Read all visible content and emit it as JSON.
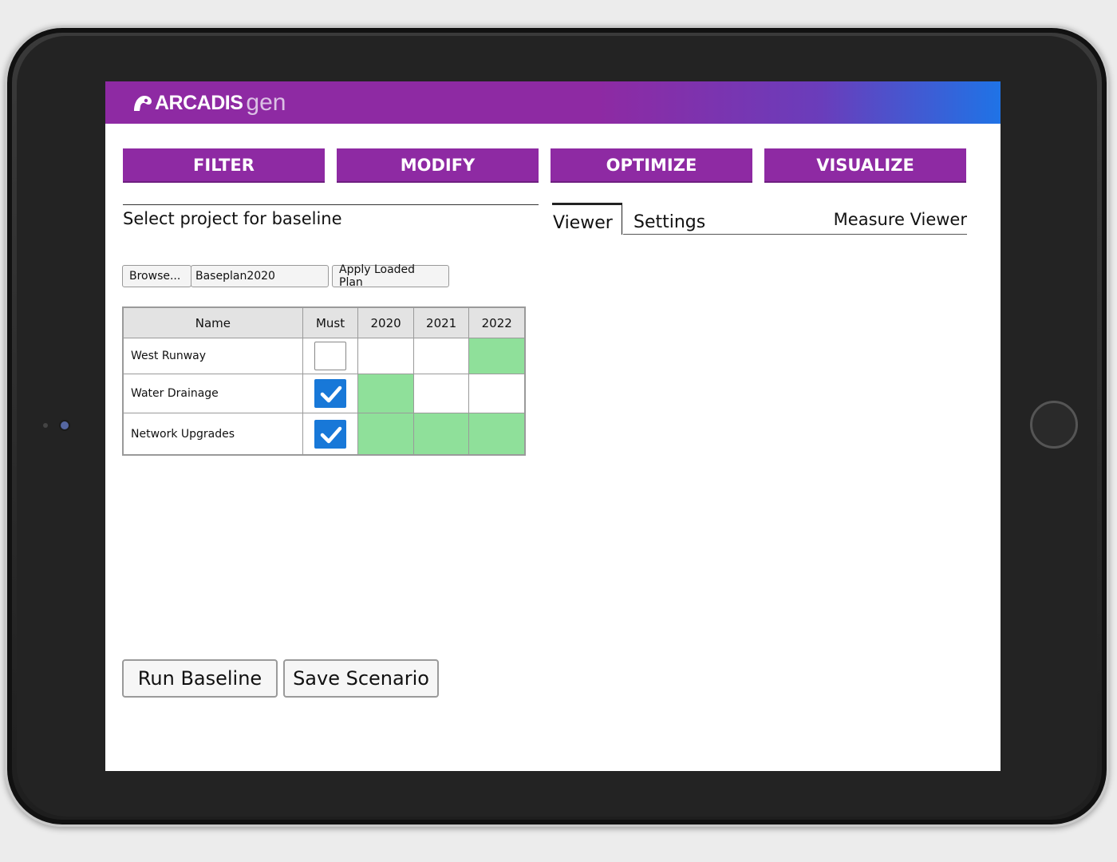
{
  "app": {
    "logo_main": "ARCADIS",
    "logo_sub": "gen"
  },
  "nav": {
    "items": [
      {
        "label": "FILTER"
      },
      {
        "label": "MODIFY"
      },
      {
        "label": "OPTIMIZE"
      },
      {
        "label": "VISUALIZE"
      }
    ],
    "color": "#8e2aa3"
  },
  "baseline_panel": {
    "title": "Select project for baseline",
    "browse_label": "Browse...",
    "file_value": "Baseplan2020",
    "apply_label": "Apply Loaded Plan",
    "table": {
      "headers": [
        "Name",
        "Must",
        "2020",
        "2021",
        "2022"
      ],
      "rows": [
        {
          "name": "West Runway",
          "must": false,
          "years": [
            false,
            false,
            true
          ]
        },
        {
          "name": "Water Drainage",
          "must": true,
          "years": [
            true,
            false,
            false
          ]
        },
        {
          "name": "Network Upgrades",
          "must": true,
          "years": [
            true,
            true,
            true
          ]
        }
      ],
      "active_cell_color": "#8fe09a",
      "checkbox_color": "#1878d8"
    },
    "run_label": "Run Baseline",
    "save_label": "Save Scenario"
  },
  "viewer_panel": {
    "tabs": [
      {
        "label": "Viewer",
        "active": true
      },
      {
        "label": "Settings",
        "active": false
      }
    ],
    "title": "Measure Viewer"
  }
}
